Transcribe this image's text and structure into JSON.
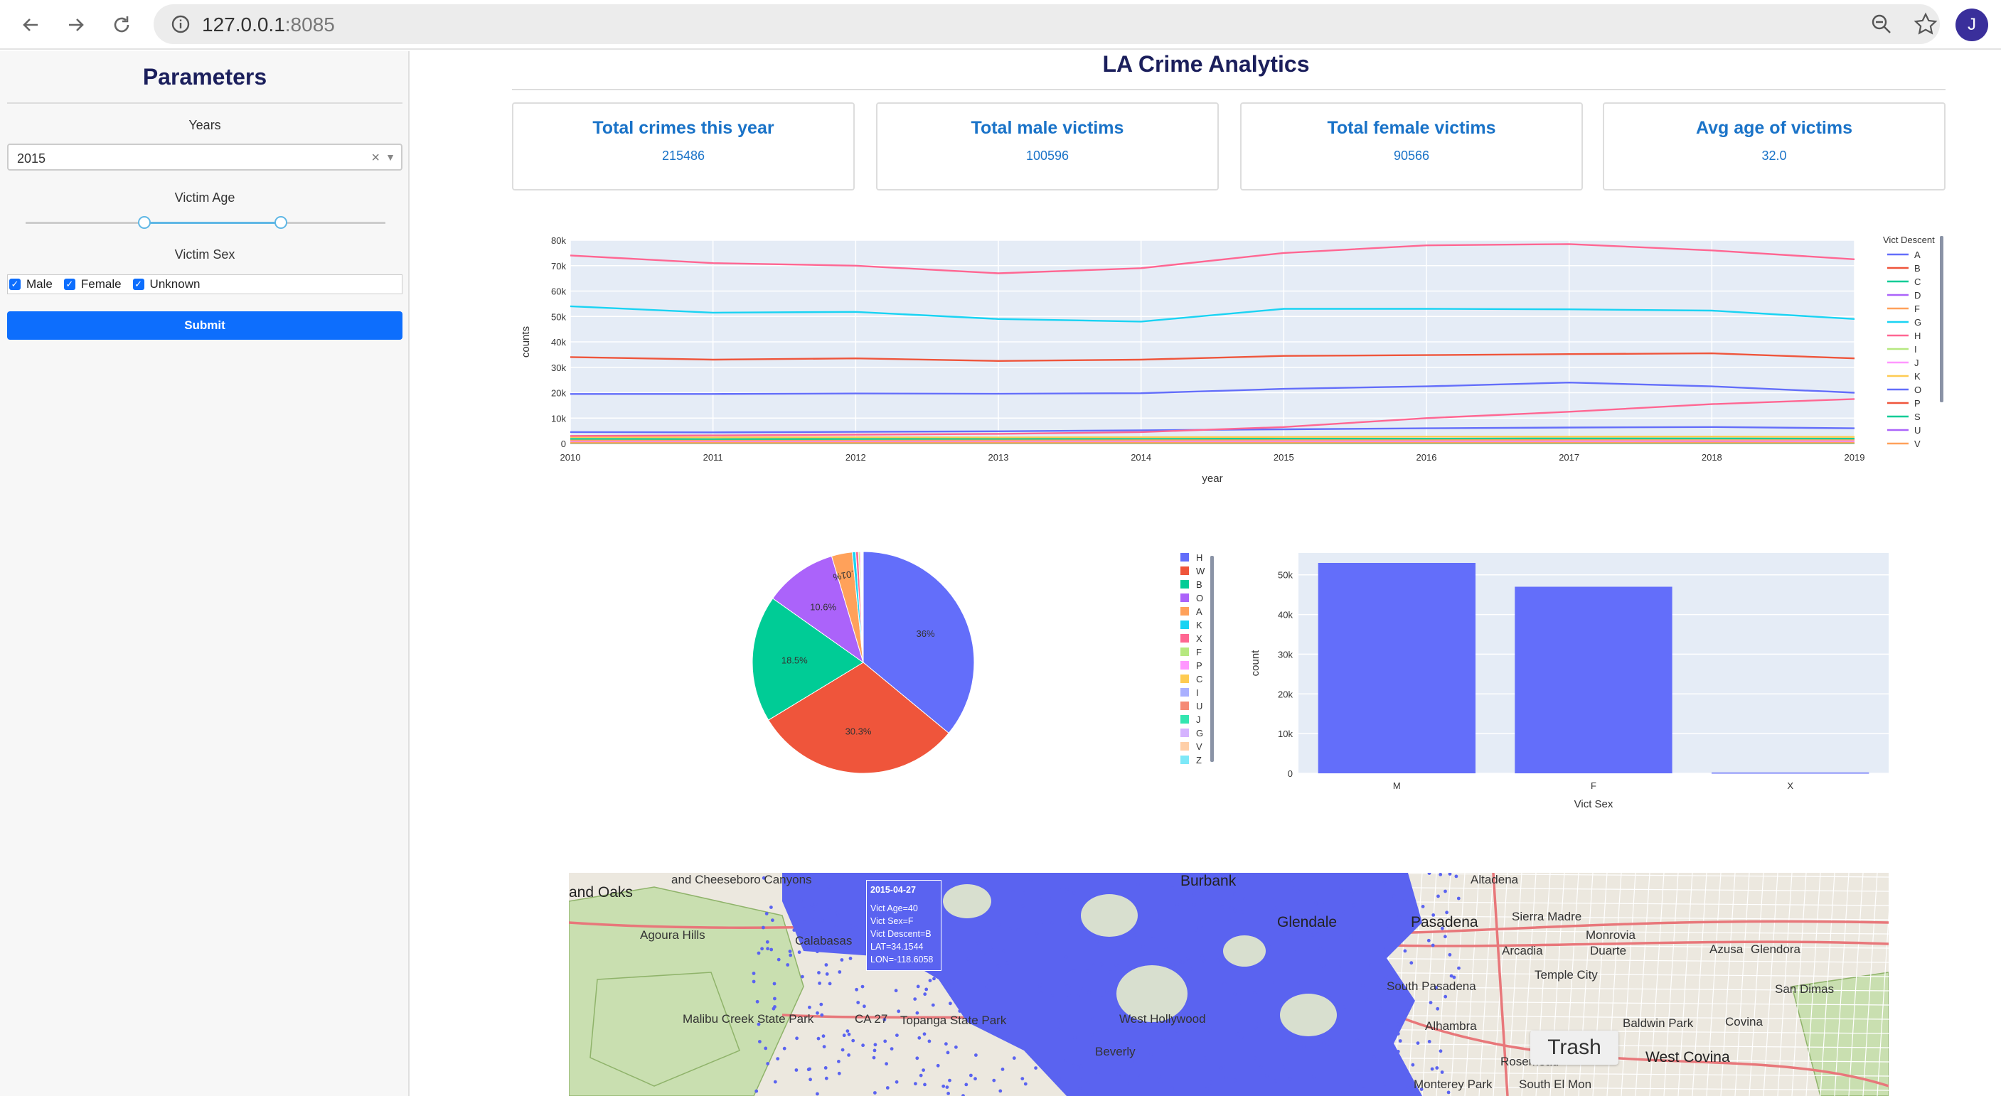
{
  "browser": {
    "url_host": "127.0.0.1",
    "url_port": ":8085",
    "avatar_letter": "J"
  },
  "sidebar": {
    "title": "Parameters",
    "years_label": "Years",
    "years_value": "2015",
    "clear_glyph": "×",
    "age_label": "Victim Age",
    "age_range_fraction": [
      0.33,
      0.71
    ],
    "sex_label": "Victim Sex",
    "sex_options": [
      {
        "label": "Male",
        "checked": true
      },
      {
        "label": "Female",
        "checked": true
      },
      {
        "label": "Unknown",
        "checked": true
      }
    ],
    "submit_label": "Submit"
  },
  "main": {
    "title": "LA Crime Analytics",
    "cards": [
      {
        "title": "Total crimes this year",
        "value": "215486"
      },
      {
        "title": "Total male victims",
        "value": "100596"
      },
      {
        "title": "Total female victims",
        "value": "90566"
      },
      {
        "title": "Avg age of victims",
        "value": "32.0"
      }
    ]
  },
  "colors": {
    "accent": "#0d6efd",
    "card_text": "#1a73c8",
    "title": "#1b1f5c",
    "plot_bg": "#e5ecf6",
    "bar": "#636efa",
    "map_points": "#5a63f0"
  },
  "chart_data": [
    {
      "type": "line",
      "xlabel": "year",
      "ylabel": "counts",
      "legend_title": "Vict Descent",
      "legend_position": "right",
      "x": [
        2010,
        2011,
        2012,
        2013,
        2014,
        2015,
        2016,
        2017,
        2018,
        2019
      ],
      "ylim": [
        0,
        80000
      ],
      "yticks": [
        "0",
        "10k",
        "20k",
        "30k",
        "40k",
        "50k",
        "60k",
        "70k",
        "80k"
      ],
      "series": [
        {
          "name": "A",
          "color": "#636efa",
          "values": [
            4500,
            4400,
            4600,
            4800,
            5200,
            5600,
            6000,
            6300,
            6500,
            6000
          ]
        },
        {
          "name": "B",
          "color": "#EF553B",
          "values": [
            34000,
            33000,
            33500,
            32500,
            33000,
            34500,
            34800,
            35200,
            35500,
            33500
          ]
        },
        {
          "name": "C",
          "color": "#00cc96",
          "values": [
            1800,
            1700,
            1750,
            1800,
            1800,
            1900,
            1900,
            2000,
            2000,
            1900
          ]
        },
        {
          "name": "D",
          "color": "#ab63fa",
          "values": [
            600,
            600,
            620,
            640,
            650,
            700,
            700,
            720,
            730,
            700
          ]
        },
        {
          "name": "F",
          "color": "#FFA15A",
          "values": [
            1200,
            1150,
            1150,
            1200,
            1250,
            1300,
            1300,
            1350,
            1300,
            1250
          ]
        },
        {
          "name": "G",
          "color": "#19d3f3",
          "values": [
            54000,
            51500,
            51800,
            49000,
            48000,
            53000,
            53000,
            52800,
            52300,
            49000
          ]
        },
        {
          "name": "H",
          "color": "#FF6692",
          "values": [
            74000,
            71000,
            70000,
            67000,
            69000,
            75000,
            78000,
            78500,
            76000,
            72500
          ]
        },
        {
          "name": "I",
          "color": "#B6E880",
          "values": [
            200,
            200,
            210,
            220,
            230,
            240,
            250,
            260,
            260,
            250
          ]
        },
        {
          "name": "J",
          "color": "#FF97FF",
          "values": [
            700,
            700,
            720,
            730,
            760,
            800,
            820,
            850,
            860,
            830
          ]
        },
        {
          "name": "K",
          "color": "#FECB52",
          "values": [
            2500,
            2400,
            2450,
            2400,
            2500,
            2600,
            2700,
            2700,
            2750,
            2600
          ]
        },
        {
          "name": "O",
          "color": "#636efa",
          "values": [
            19500,
            19500,
            19700,
            19600,
            19800,
            21500,
            22500,
            24000,
            22500,
            20000
          ]
        },
        {
          "name": "P",
          "color": "#EF553B",
          "values": [
            300,
            300,
            320,
            330,
            340,
            350,
            360,
            370,
            380,
            360
          ]
        },
        {
          "name": "S",
          "color": "#00cc96",
          "values": [
            100,
            100,
            110,
            110,
            120,
            120,
            130,
            130,
            140,
            130
          ]
        },
        {
          "name": "U",
          "color": "#ab63fa",
          "values": [
            300,
            300,
            310,
            320,
            330,
            340,
            350,
            360,
            370,
            350
          ]
        },
        {
          "name": "V",
          "color": "#FFA15A",
          "values": [
            250,
            250,
            260,
            270,
            280,
            290,
            300,
            310,
            320,
            300
          ]
        },
        {
          "name": "X",
          "color": "#FF6692",
          "values": [
            3000,
            3200,
            3500,
            3800,
            4500,
            6500,
            10000,
            12500,
            15500,
            17500
          ]
        }
      ],
      "legend_visible": [
        "A",
        "B",
        "C",
        "D",
        "F",
        "G",
        "H",
        "I",
        "J",
        "K",
        "O",
        "P",
        "S",
        "U",
        "V"
      ]
    },
    {
      "type": "pie",
      "slices": [
        {
          "label": "H",
          "value": 36.0,
          "text": "36%",
          "color": "#636efa"
        },
        {
          "label": "W",
          "value": 30.3,
          "text": "30.3%",
          "color": "#EF553B"
        },
        {
          "label": "B",
          "value": 18.5,
          "text": "18.5%",
          "color": "#00cc96"
        },
        {
          "label": "O",
          "value": 10.6,
          "text": "10.6%",
          "color": "#ab63fa"
        },
        {
          "label": "A",
          "value": 3.01,
          "text": "3.01%",
          "color": "#FFA15A"
        },
        {
          "label": "K",
          "value": 0.5,
          "text": "",
          "color": "#19d3f3"
        },
        {
          "label": "X",
          "value": 0.4,
          "text": "",
          "color": "#FF6692"
        },
        {
          "label": "F",
          "value": 0.2,
          "text": "",
          "color": "#B6E880"
        },
        {
          "label": "P",
          "value": 0.15,
          "text": "",
          "color": "#FF97FF"
        },
        {
          "label": "C",
          "value": 0.1,
          "text": "",
          "color": "#FECB52"
        },
        {
          "label": "I",
          "value": 0.08,
          "text": "",
          "color": "#a9b0ff"
        },
        {
          "label": "U",
          "value": 0.06,
          "text": "",
          "color": "#f58a75"
        },
        {
          "label": "J",
          "value": 0.04,
          "text": "",
          "color": "#33e6b0"
        },
        {
          "label": "G",
          "value": 0.03,
          "text": "",
          "color": "#d5b3ff"
        },
        {
          "label": "V",
          "value": 0.02,
          "text": "",
          "color": "#ffcfa8"
        },
        {
          "label": "Z",
          "value": 0.01,
          "text": "",
          "color": "#7de8f8"
        }
      ]
    },
    {
      "type": "bar",
      "xlabel": "Vict Sex",
      "ylabel": "count",
      "categories": [
        "M",
        "F",
        "X"
      ],
      "values": [
        53000,
        47000,
        200
      ],
      "ylim": [
        0,
        55500
      ],
      "yticks": [
        "0",
        "10k",
        "20k",
        "30k",
        "40k",
        "50k"
      ]
    }
  ],
  "map": {
    "places": [
      {
        "text": "and Oaks",
        "big": true
      },
      {
        "text": "and Cheeseboro Canyons",
        "big": false
      },
      {
        "text": "Agoura Hills",
        "big": false
      },
      {
        "text": "Calabasas",
        "big": false
      },
      {
        "text": "Malibu Creek State Park",
        "big": false
      },
      {
        "text": "CA 27",
        "big": false
      },
      {
        "text": "Topanga State Park",
        "big": false
      },
      {
        "text": "Burbank",
        "big": true
      },
      {
        "text": "Glendale",
        "big": true
      },
      {
        "text": "Pasadena",
        "big": true
      },
      {
        "text": "Altadena",
        "big": false
      },
      {
        "text": "Sierra Madre",
        "big": false
      },
      {
        "text": "Monrovia",
        "big": false
      },
      {
        "text": "Arcadia",
        "big": false
      },
      {
        "text": "Duarte",
        "big": false
      },
      {
        "text": "Azusa",
        "big": false
      },
      {
        "text": "Glendora",
        "big": false
      },
      {
        "text": "South Pasadena",
        "big": false
      },
      {
        "text": "Temple City",
        "big": false
      },
      {
        "text": "San Dimas",
        "big": false
      },
      {
        "text": "Alhambra",
        "big": false
      },
      {
        "text": "Baldwin Park",
        "big": false
      },
      {
        "text": "Covina",
        "big": false
      },
      {
        "text": "Rosemead",
        "big": false
      },
      {
        "text": "West Covina",
        "big": true
      },
      {
        "text": "West Hollywood",
        "big": false
      },
      {
        "text": "Beverly",
        "big": false
      },
      {
        "text": "Monterey Park",
        "big": false
      },
      {
        "text": "South El Mon",
        "big": false
      }
    ],
    "tooltip": {
      "date": "2015-04-27",
      "lines": [
        "Vict Age=40",
        "Vict Sex=F",
        "Vict Descent=B",
        "LAT=34.1544",
        "LON=-118.6058"
      ]
    },
    "trash_label": "Trash"
  }
}
